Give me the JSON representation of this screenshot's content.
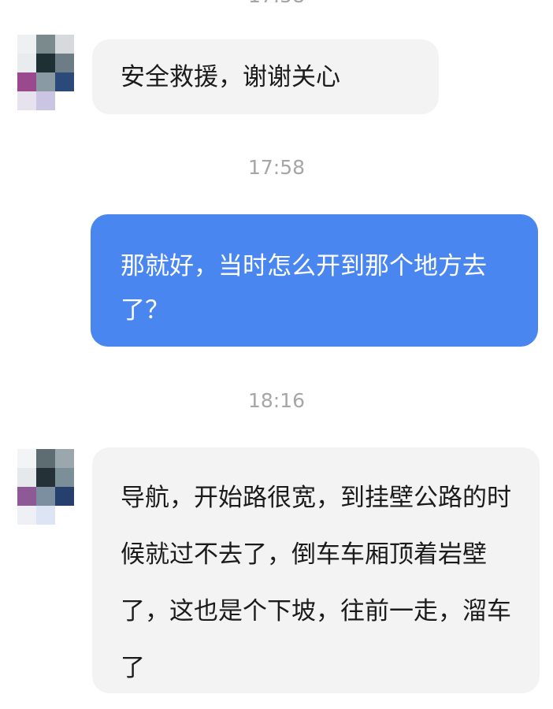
{
  "chat": {
    "timestamps": [
      "17:58",
      "18:16"
    ],
    "messages": [
      {
        "sender": "contact",
        "text": "安全救援，谢谢关心"
      },
      {
        "sender": "me",
        "text": "那就好，当时怎么开到那个地方去了？"
      },
      {
        "sender": "contact",
        "text": "导航，开始路很宽，到挂壁公路的时候就过不去了，倒车车厢顶着岩壁了，这也是个下坡，往前一走，溜车了"
      }
    ]
  },
  "colors": {
    "incoming_bubble": "#f3f3f4",
    "outgoing_bubble": "#4a86f0",
    "timestamp_text": "#a6a6a6"
  },
  "avatar_pixels": {
    "contact_avatar_1": [
      "#eef0f2",
      "#7a8a8d",
      "#d6dadd",
      "#e9ecee",
      "#1f3035",
      "#6d7d86",
      "#9a4a8c",
      "#8a9aa3",
      "#2b4a7a",
      "#e6e2ee",
      "#c9c5e3",
      "#ffffff"
    ],
    "contact_avatar_2": [
      "#f3f4f5",
      "#5e6d72",
      "#9aa7ad",
      "#e6e9eb",
      "#243238",
      "#7b8f98",
      "#8e5a96",
      "#7c8fa0",
      "#26406e",
      "#eef0f6",
      "#dde4f4",
      "#ffffff"
    ]
  }
}
